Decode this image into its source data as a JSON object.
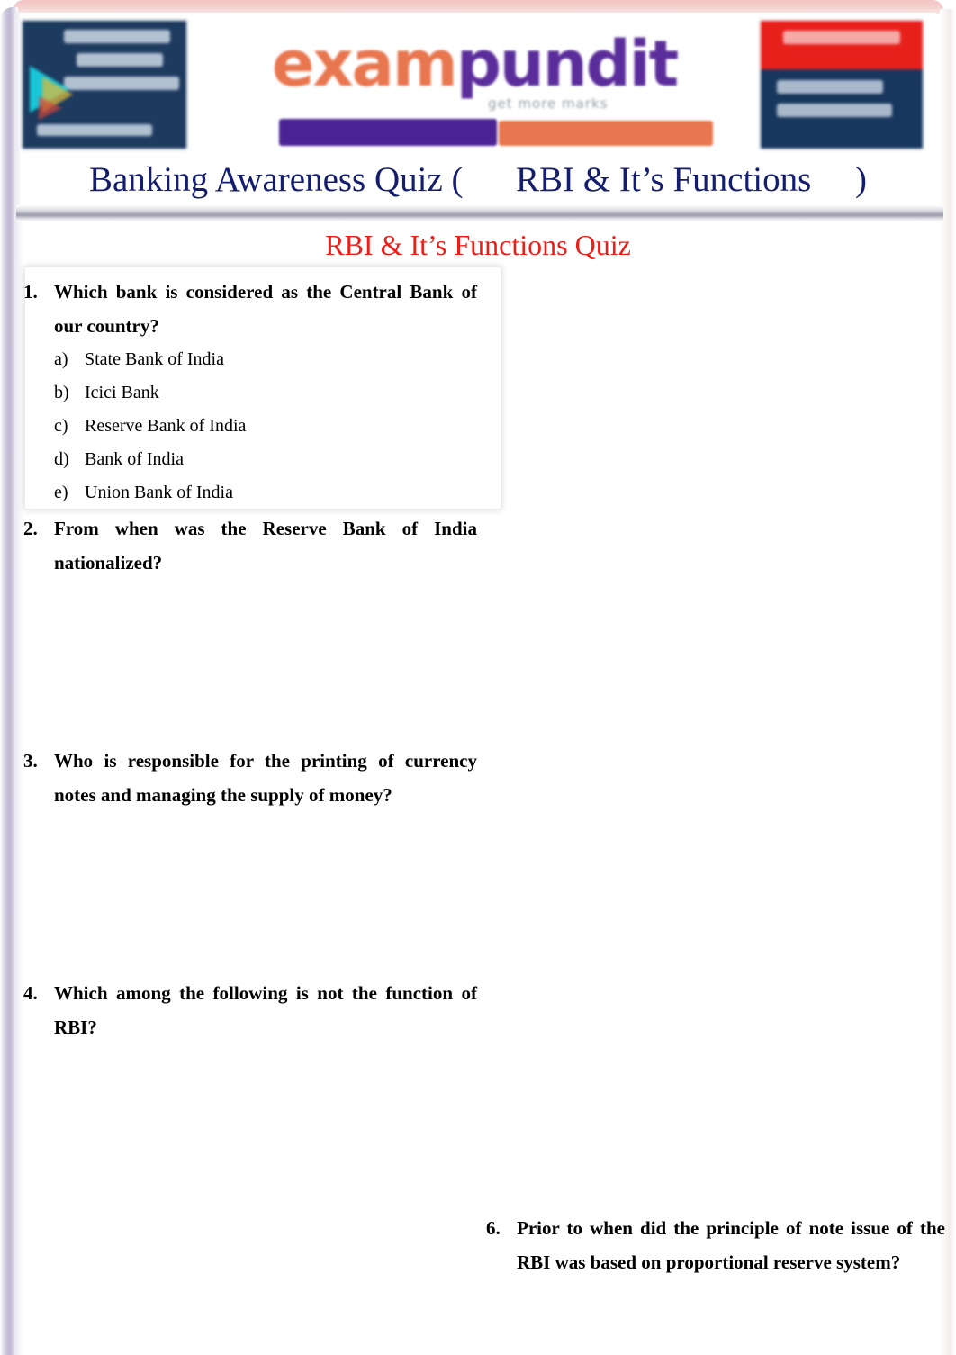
{
  "document": {
    "header": {
      "title": "Banking Awareness Quiz (      RBI & It’s Functions     )",
      "logo": {
        "exam_text": "exam",
        "pundit_text": "pundit",
        "tagline": "get more marks"
      },
      "badge_left": {
        "name": "google-play-app-badge"
      },
      "badge_right": {
        "name": "special-offer-badge"
      }
    },
    "quiz_heading": "RBI & It’s Functions Quiz",
    "questions_left": [
      {
        "number": "1.",
        "text": "Which bank is considered as the Central Bank of our country?",
        "options": [
          {
            "key": "a)",
            "value": "State Bank of India"
          },
          {
            "key": "b)",
            "value": "Icici Bank"
          },
          {
            "key": "c)",
            "value": "Reserve Bank of India"
          },
          {
            "key": "d)",
            "value": "Bank of India"
          },
          {
            "key": "e)",
            "value": "Union Bank of India"
          }
        ]
      },
      {
        "number": "2.",
        "text": "From when was the Reserve Bank of India nationalized?",
        "options": []
      },
      {
        "number": "3.",
        "text": "Who is responsible for the printing of currency notes and managing the supply of money?",
        "options": []
      },
      {
        "number": "4.",
        "text": "Which among the following is not the function of RBI?",
        "options": []
      }
    ],
    "questions_right": [
      {
        "number": "6.",
        "text": "Prior to when did the principle of note issue of the RBI was based on proportional reserve system?",
        "options": []
      }
    ],
    "colors": {
      "title_navy": "#141d6e",
      "heading_red": "#ee1d18",
      "logo_orange": "#e8764f",
      "logo_purple": "#4a2395",
      "badge_navy": "#17375e",
      "badge_red": "#e8201c",
      "frame_pink": "#f2c4c2",
      "frame_lavender": "#bcb6d0"
    }
  }
}
